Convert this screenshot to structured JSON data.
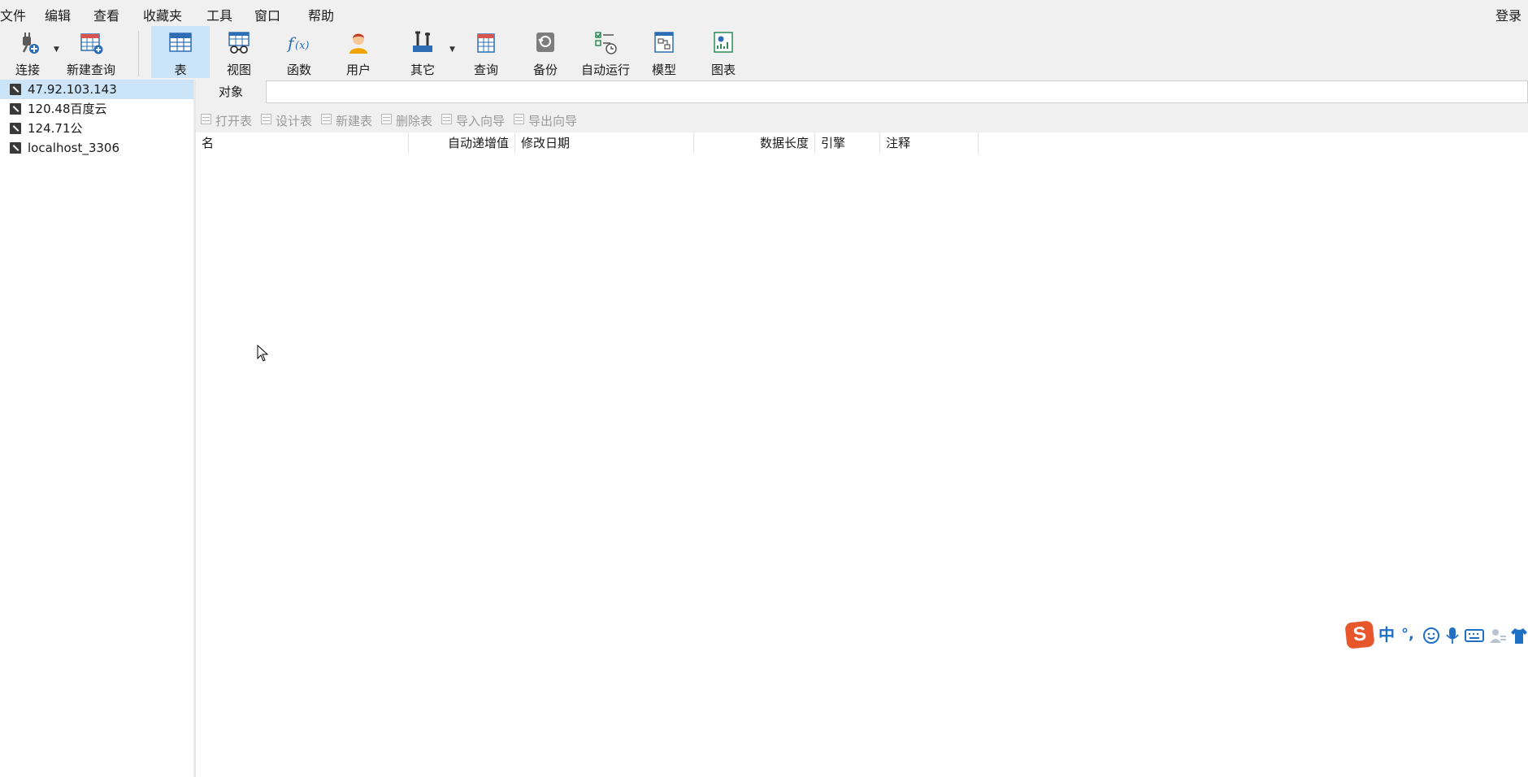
{
  "menubar": {
    "items": [
      "文件",
      "编辑",
      "查看",
      "收藏夹",
      "工具",
      "窗口",
      "帮助"
    ],
    "login": "登录"
  },
  "toolbar": {
    "connect": "连接",
    "new_query": "新建查询",
    "table": "表",
    "view": "视图",
    "function": "函数",
    "user": "用户",
    "other": "其它",
    "query": "查询",
    "backup": "备份",
    "auto_run": "自动运行",
    "model": "模型",
    "chart": "图表"
  },
  "sidebar": {
    "connections": [
      "47.92.103.143",
      "120.48百度云",
      "124.71公",
      "localhost_3306"
    ],
    "selected_index": 0
  },
  "objects": {
    "tab": "对象",
    "search_value": "",
    "tools": [
      "打开表",
      "设计表",
      "新建表",
      "删除表",
      "导入向导",
      "导出向导"
    ],
    "columns": [
      "名",
      "自动递增值",
      "修改日期",
      "数据长度",
      "引擎",
      "注释"
    ],
    "rows": []
  },
  "ime": {
    "mode": "中",
    "punct": "°,"
  },
  "colors": {
    "selected_bg": "#cce4f7",
    "toolbar_bg": "#f0f0f0",
    "icon_blue": "#2e6db4",
    "ime_orange": "#e8572c"
  }
}
